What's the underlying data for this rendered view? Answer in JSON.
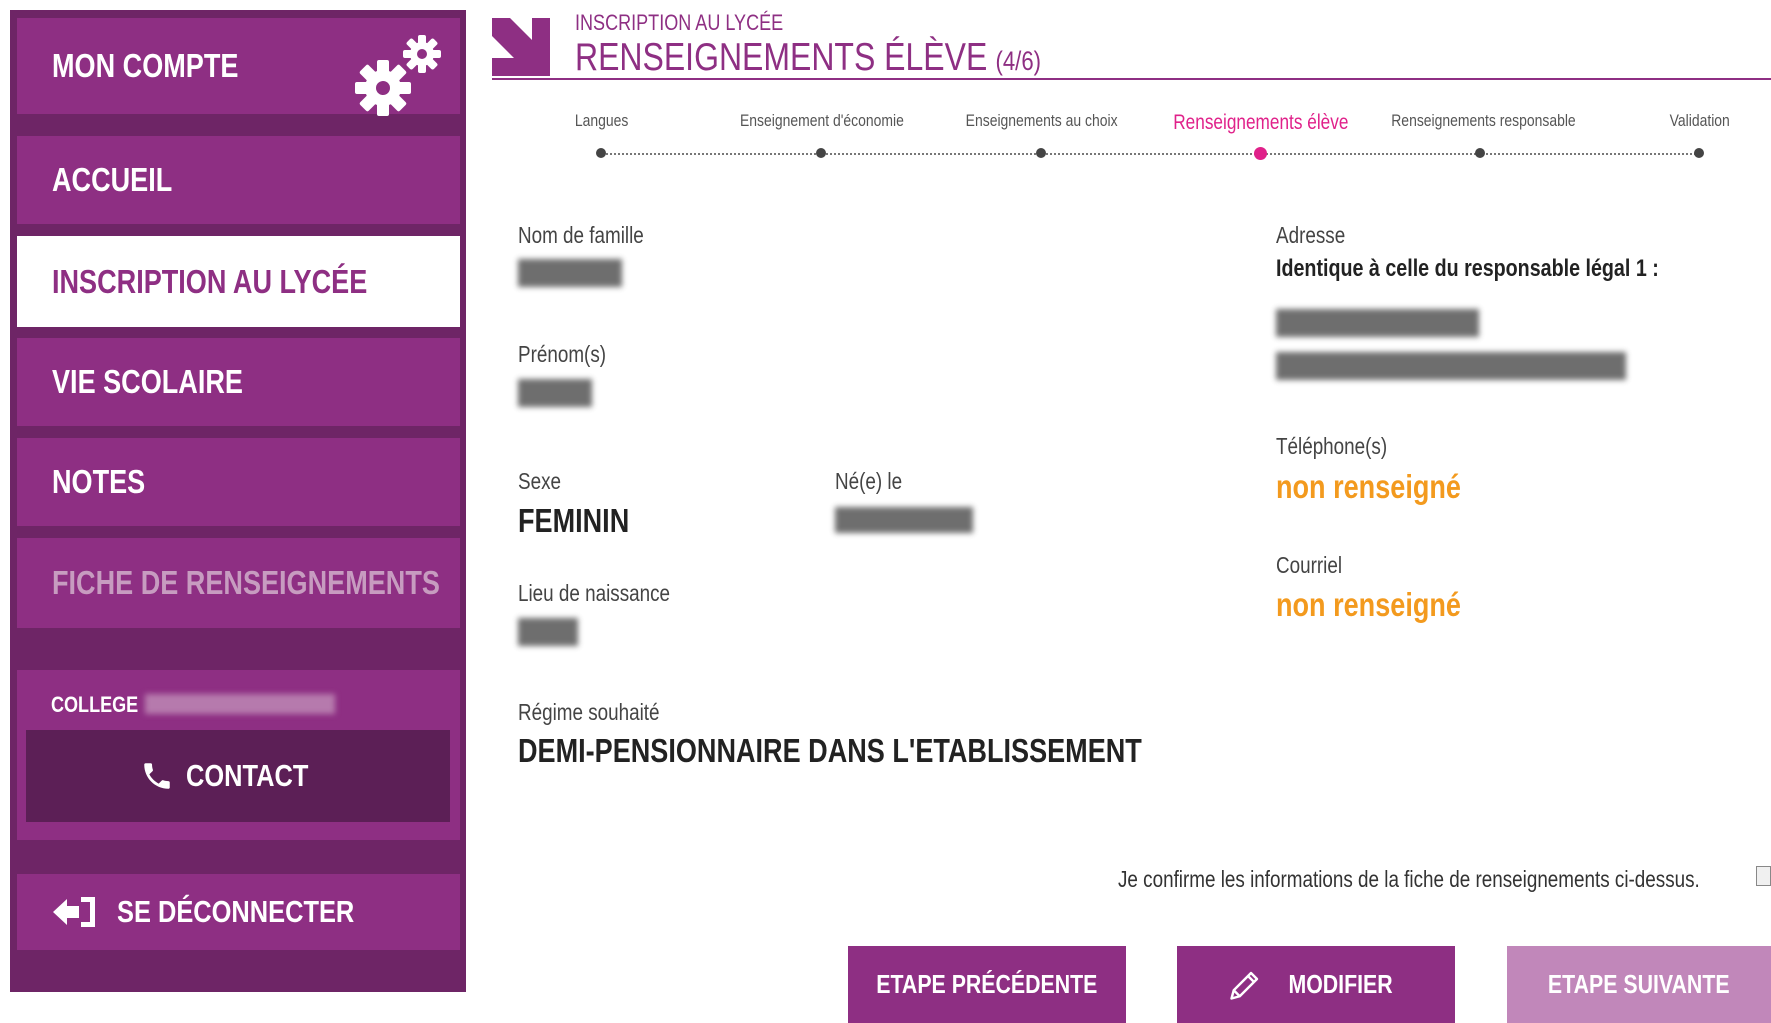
{
  "sidebar": {
    "items": [
      {
        "label": "MON COMPTE"
      },
      {
        "label": "ACCUEIL"
      },
      {
        "label": "INSCRIPTION AU LYCÉE"
      },
      {
        "label": "VIE SCOLAIRE"
      },
      {
        "label": "NOTES"
      },
      {
        "label": "FICHE DE RENSEIGNEMENTS"
      }
    ],
    "college_label": "COLLEGE",
    "contact_label": "CONTACT",
    "logout_label": "SE DÉCONNECTER"
  },
  "header": {
    "super_title": "INSCRIPTION AU LYCÉE",
    "title": "RENSEIGNEMENTS ÉLÈVE",
    "step": "(4/6)"
  },
  "stepper": {
    "steps": [
      {
        "label": "Langues"
      },
      {
        "label": "Enseignement d'économie"
      },
      {
        "label": "Enseignements au choix"
      },
      {
        "label": "Renseignements élève"
      },
      {
        "label": "Renseignements responsable"
      },
      {
        "label": "Validation"
      }
    ],
    "active_index": 3
  },
  "form": {
    "nom_label": "Nom de famille",
    "prenom_label": "Prénom(s)",
    "sexe_label": "Sexe",
    "sexe_value": "FEMININ",
    "naissance_label": "Né(e) le",
    "lieu_label": "Lieu de naissance",
    "regime_label": "Régime souhaité",
    "regime_value": "DEMI-PENSIONNAIRE DANS L'ETABLISSEMENT",
    "adresse_label": "Adresse",
    "adresse_note": "Identique à celle du responsable légal 1 :",
    "telephone_label": "Téléphone(s)",
    "telephone_value": "non renseigné",
    "courriel_label": "Courriel",
    "courriel_value": "non renseigné"
  },
  "confirm_text": "Je confirme les informations de la fiche de renseignements ci-dessus.",
  "buttons": {
    "prev": "ETAPE PRÉCÉDENTE",
    "edit": "MODIFIER",
    "next": "ETAPE SUIVANTE"
  },
  "colors": {
    "brand": "#8e2f83",
    "sidebar_bg": "#6e2566",
    "active_step": "#e0218a",
    "warning": "#f39a1e"
  }
}
